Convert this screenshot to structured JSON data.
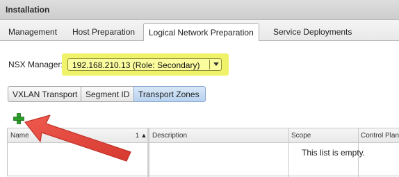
{
  "window": {
    "title": "Installation"
  },
  "tabs": [
    {
      "label": "Management"
    },
    {
      "label": "Host Preparation"
    },
    {
      "label": "Logical Network Preparation"
    },
    {
      "label": "Service Deployments"
    }
  ],
  "nsx_manager": {
    "label": "NSX Manager:",
    "selected": "192.168.210.13 (Role: Secondary)"
  },
  "sub_tabs": [
    {
      "label": "VXLAN Transport"
    },
    {
      "label": "Segment ID"
    },
    {
      "label": "Transport Zones"
    }
  ],
  "toolbar": {
    "add_icon": "plus-icon"
  },
  "table": {
    "columns": [
      {
        "label": "Name",
        "sort": "1 ▲"
      },
      {
        "label": "Description"
      },
      {
        "label": "Scope"
      },
      {
        "label": "Control Plane"
      }
    ],
    "empty_text": "This list is empty."
  },
  "colors": {
    "highlight": "#f0f26a",
    "annotation_arrow": "#e0463c",
    "add_icon": "#2e9e2a",
    "active_subtab": "#b8d2ef"
  }
}
